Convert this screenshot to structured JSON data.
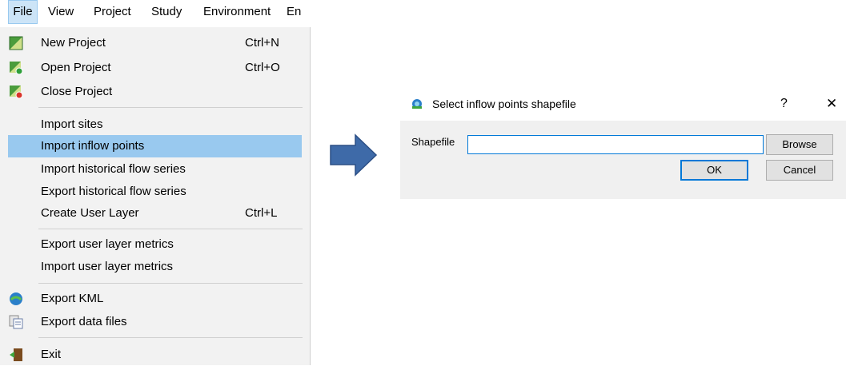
{
  "menubar": {
    "items": [
      "File",
      "View",
      "Project",
      "Study",
      "Environment",
      "En"
    ]
  },
  "file_menu": {
    "items": [
      {
        "label": "New Project",
        "shortcut": "Ctrl+N",
        "icon": "new-project-icon"
      },
      {
        "label": "Open Project",
        "shortcut": "Ctrl+O",
        "icon": "open-project-icon"
      },
      {
        "label": "Close Project",
        "shortcut": "",
        "icon": "close-project-icon"
      },
      {
        "label": "Import sites",
        "shortcut": ""
      },
      {
        "label": "Import inflow points",
        "shortcut": "",
        "highlighted": true
      },
      {
        "label": "Import historical flow series",
        "shortcut": ""
      },
      {
        "label": "Export historical flow series",
        "shortcut": ""
      },
      {
        "label": "Create User Layer",
        "shortcut": "Ctrl+L"
      },
      {
        "label": "Export user layer metrics",
        "shortcut": ""
      },
      {
        "label": "Import user layer metrics",
        "shortcut": ""
      },
      {
        "label": "Export KML",
        "shortcut": "",
        "icon": "export-kml-icon"
      },
      {
        "label": "Export data files",
        "shortcut": "",
        "icon": "export-data-files-icon"
      },
      {
        "label": "Exit",
        "shortcut": "",
        "icon": "exit-icon"
      }
    ]
  },
  "dialog": {
    "title": "Select inflow points shapefile",
    "help": "?",
    "close": "✕",
    "field_label": "Shapefile",
    "field_value": "",
    "browse_label": "Browse",
    "ok_label": "OK",
    "cancel_label": "Cancel"
  },
  "colors": {
    "highlight": "#99c9ef",
    "menu_bg": "#f2f2f2",
    "arrow": "#3e6aa8",
    "accent": "#0078d7"
  }
}
